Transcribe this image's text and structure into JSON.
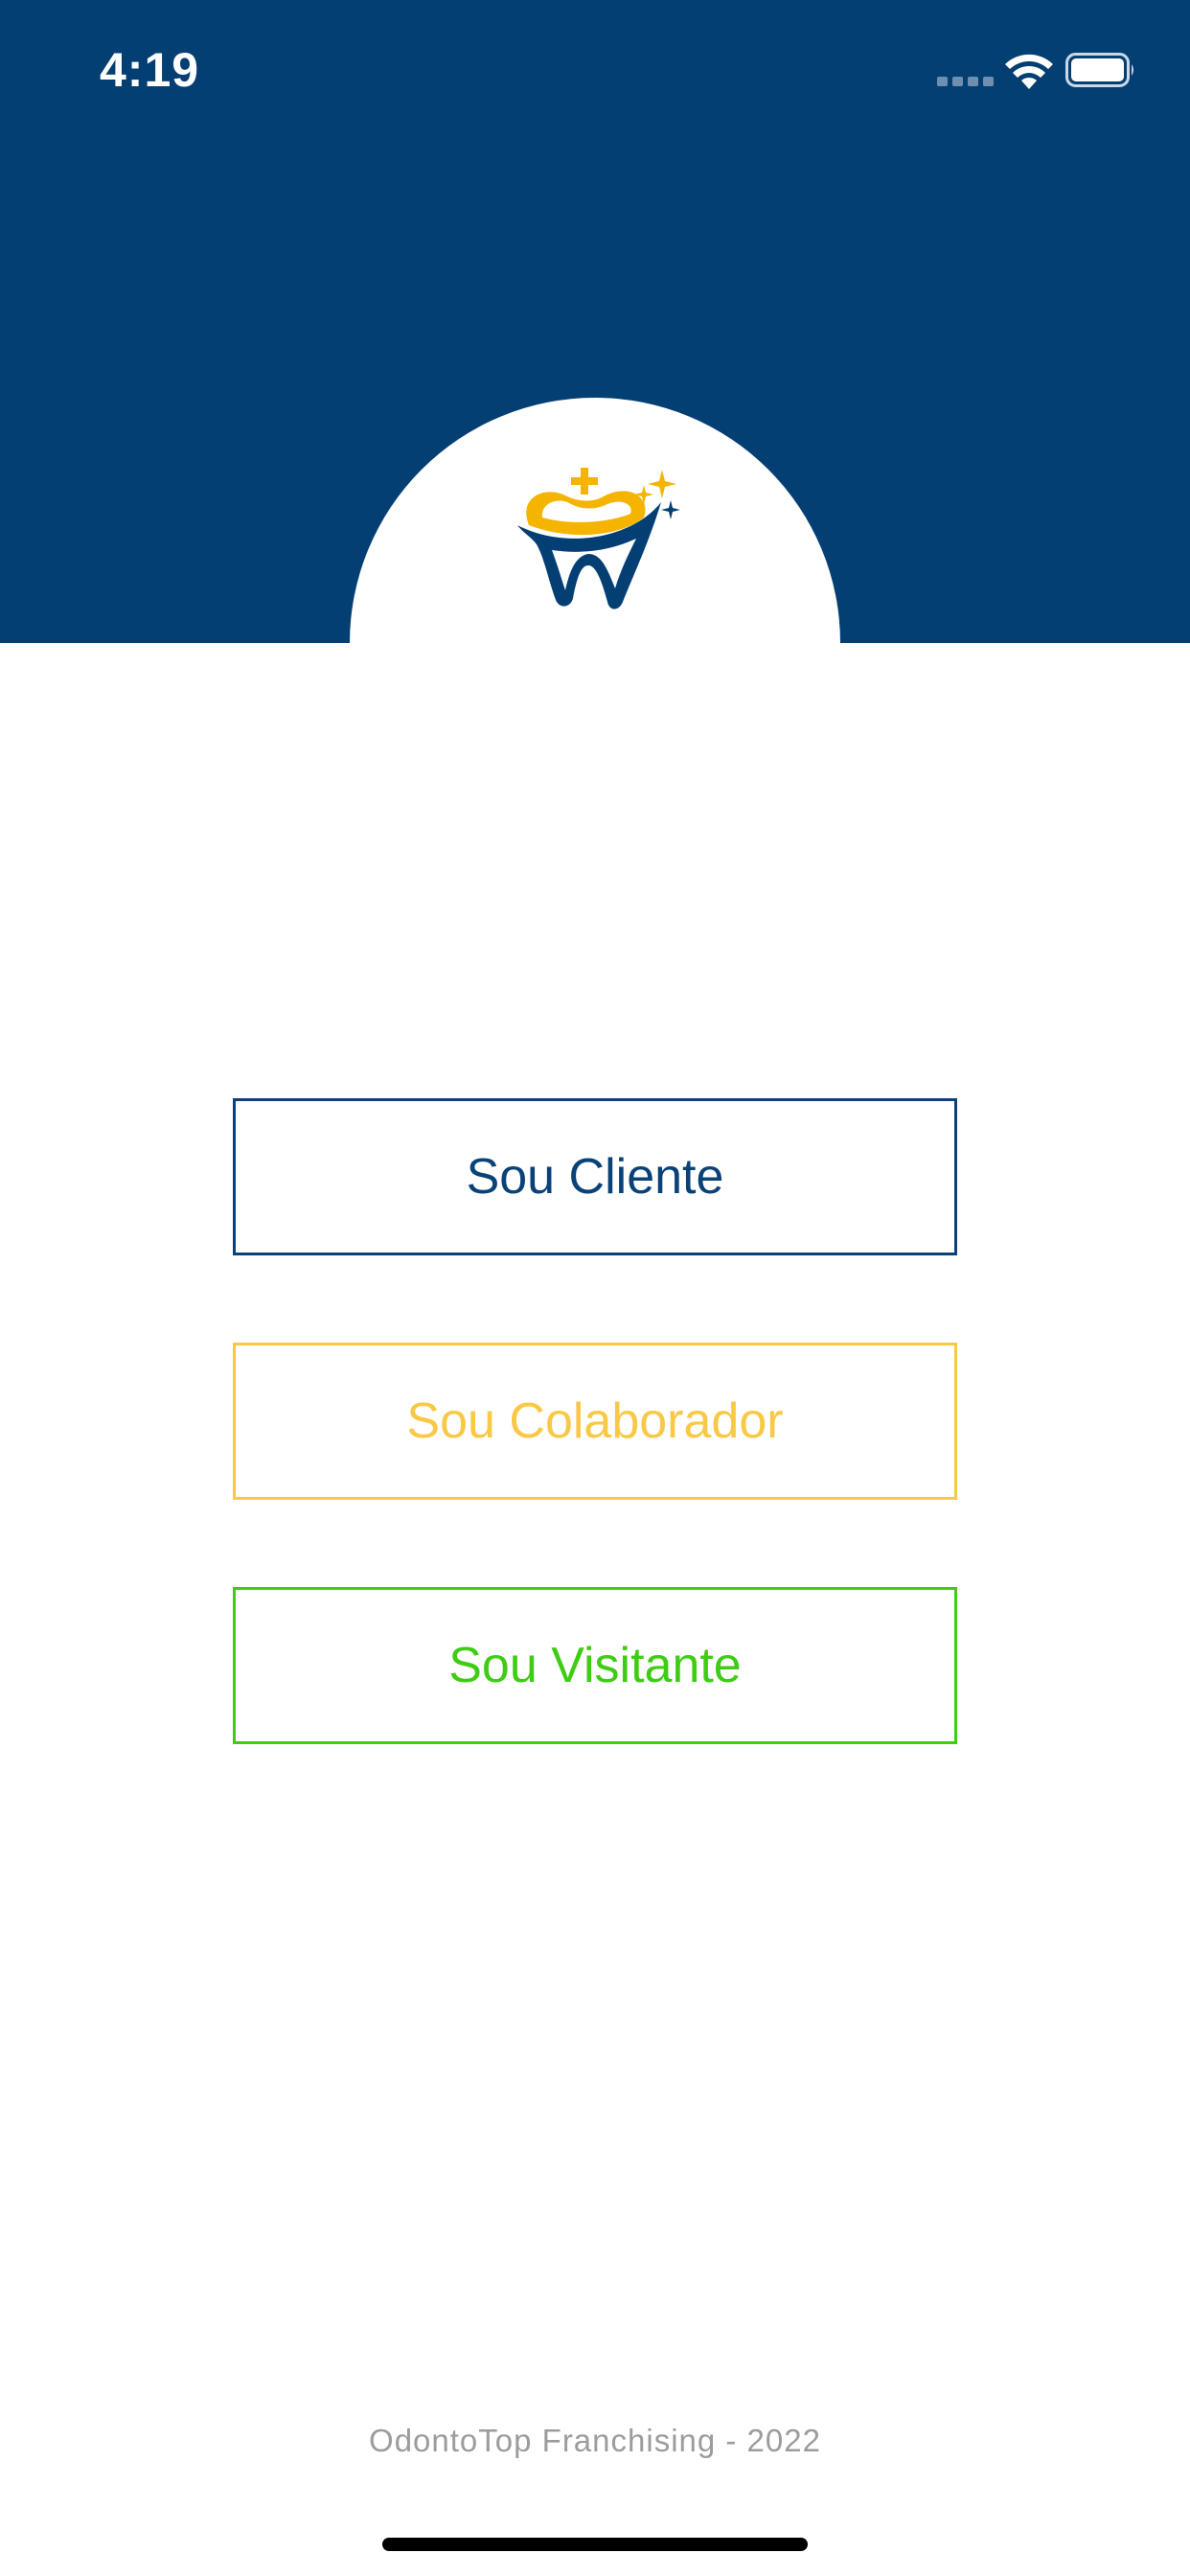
{
  "status_bar": {
    "time": "4:19"
  },
  "colors": {
    "header_bg": "#043f74",
    "client": "#0a4278",
    "collaborator": "#f9c845",
    "visitor": "#3fcd14",
    "footer_text": "#9c9c9c"
  },
  "logo": {
    "icon": "tooth-logo-icon"
  },
  "buttons": {
    "client": "Sou Cliente",
    "collaborator": "Sou Colaborador",
    "visitor": "Sou Visitante"
  },
  "footer": {
    "text": "OdontoTop Franchising - 2022"
  }
}
